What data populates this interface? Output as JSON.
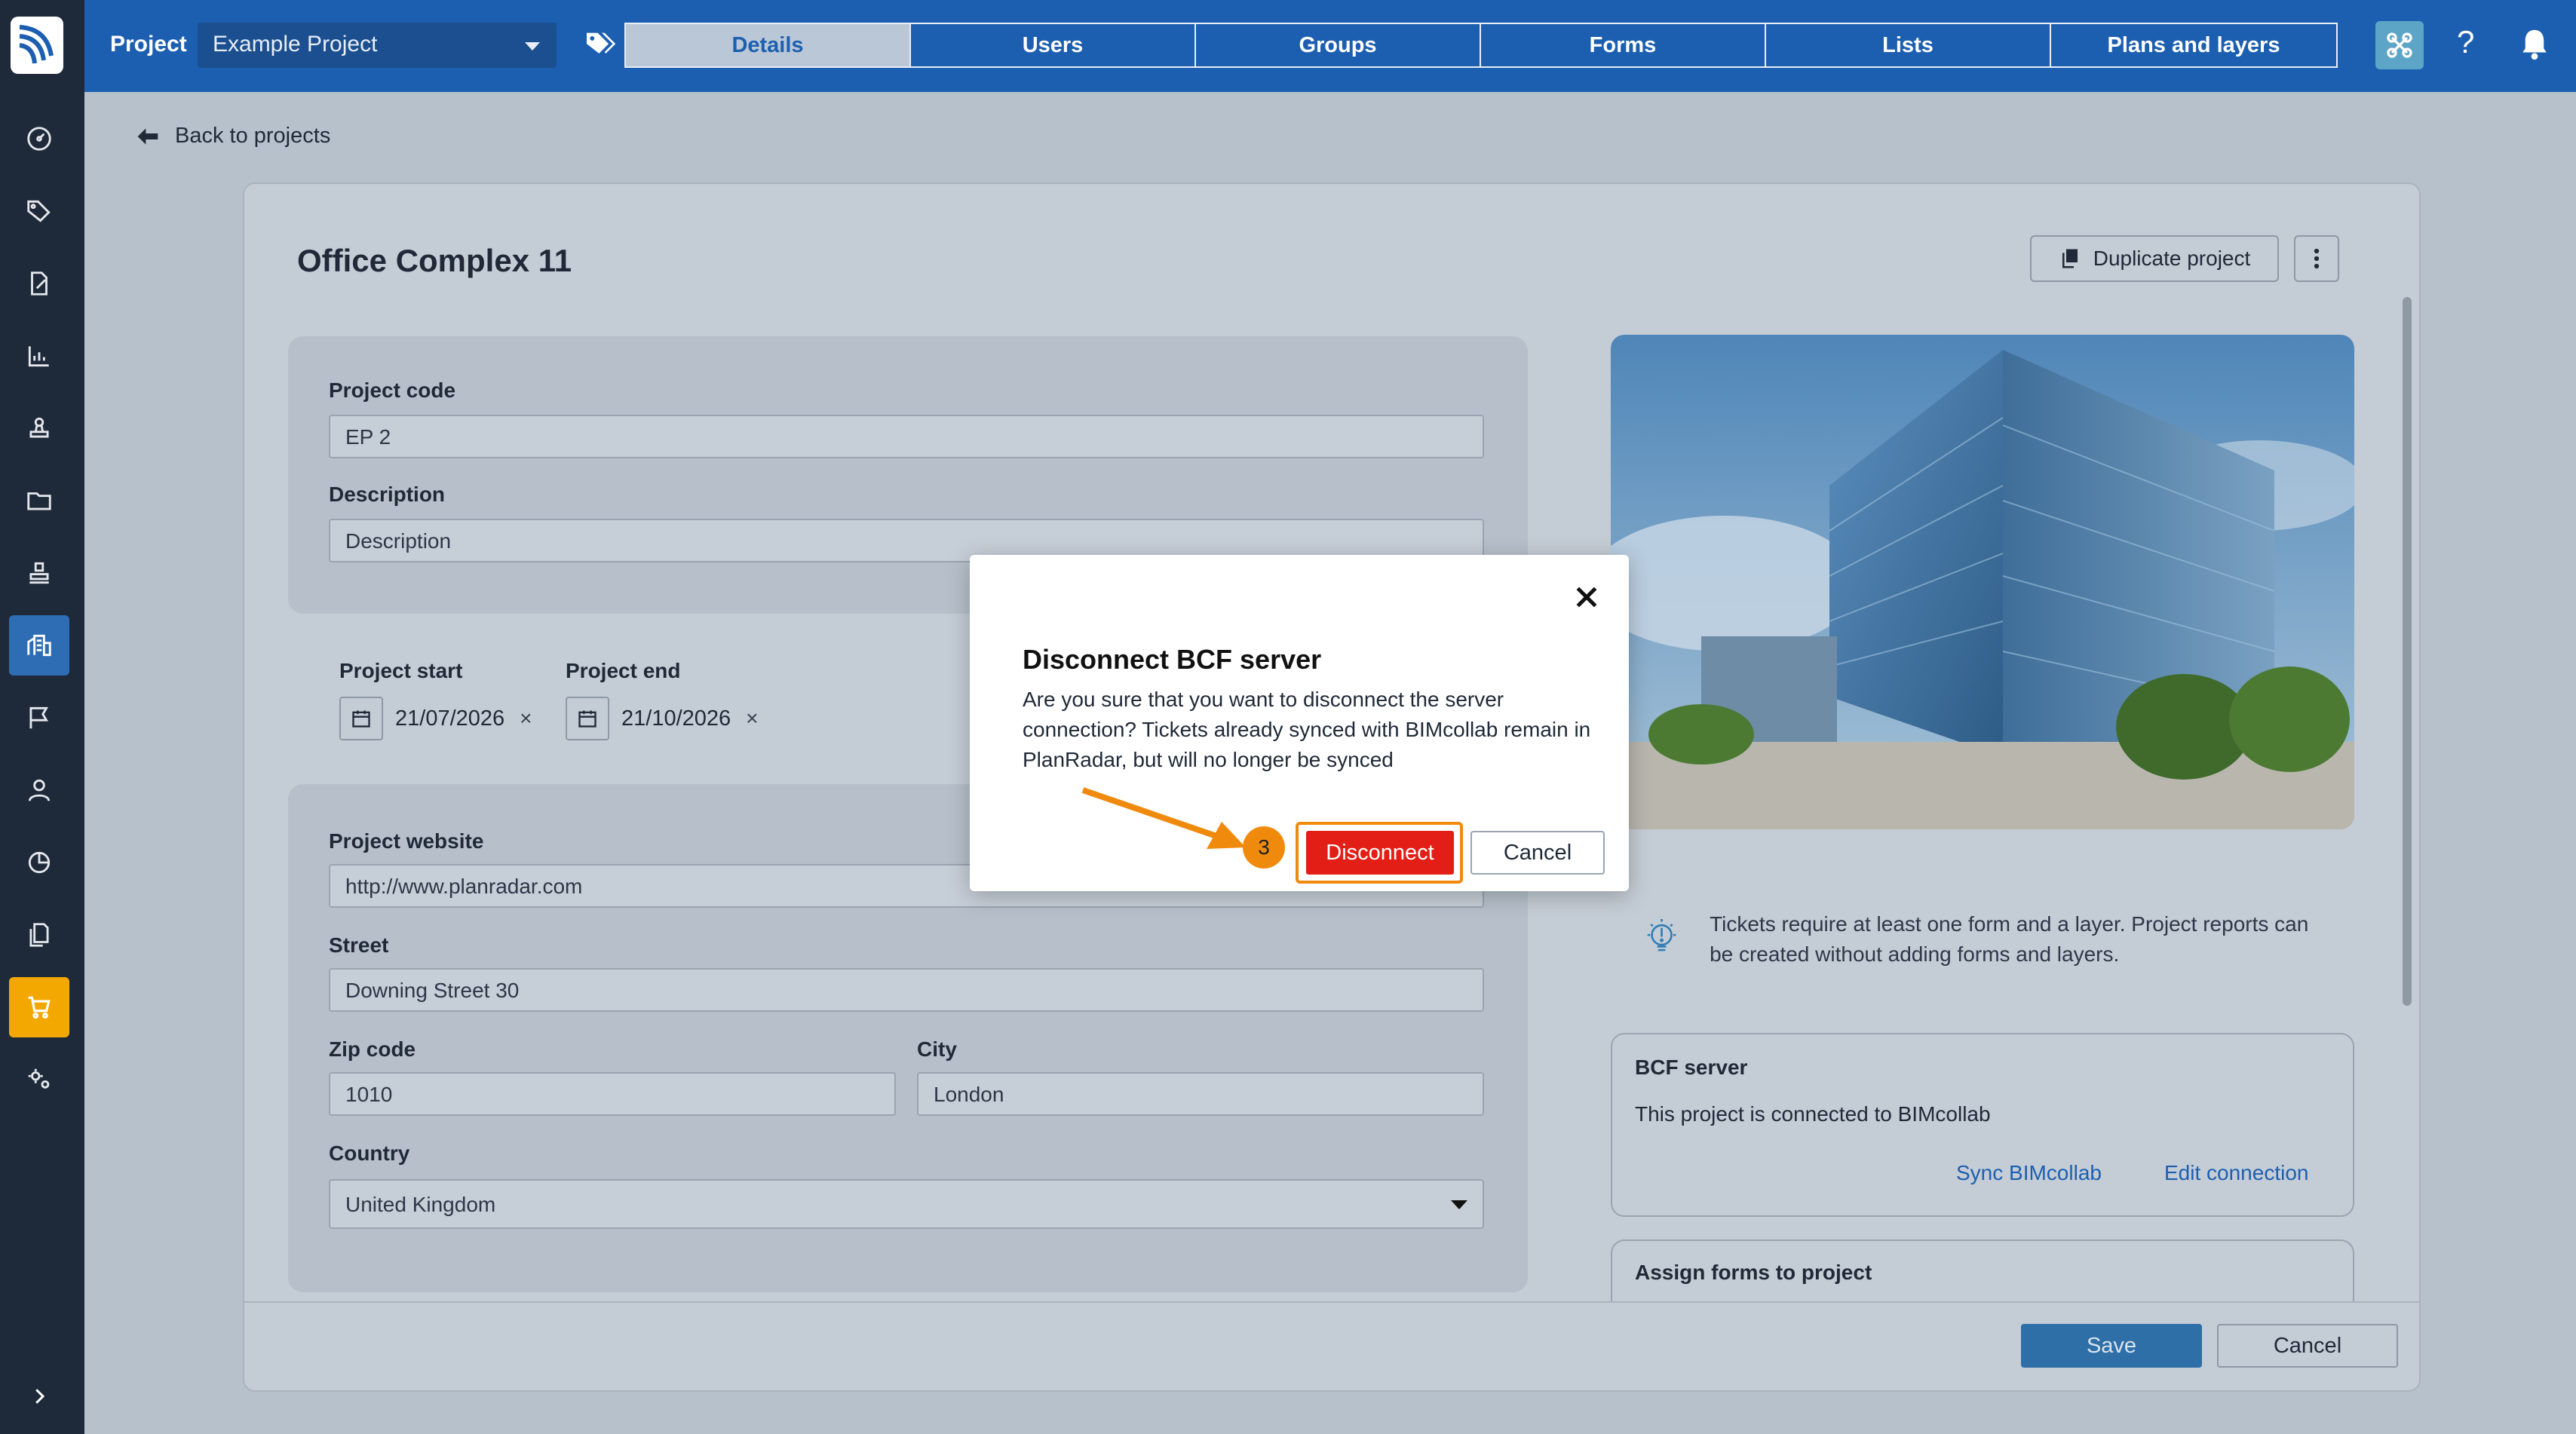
{
  "topbar": {
    "project_label": "Project",
    "project_select": "Example Project",
    "tabs": [
      {
        "label": "Details",
        "active": true
      },
      {
        "label": "Users"
      },
      {
        "label": "Groups"
      },
      {
        "label": "Forms"
      },
      {
        "label": "Lists"
      },
      {
        "label": "Plans and layers"
      }
    ],
    "help": "?"
  },
  "sidebar": {
    "items": [
      "dashboard-icon",
      "tags-icon",
      "edit-document-icon",
      "chart-icon",
      "stamp-icon",
      "folder-icon",
      "approval-icon",
      "projects-icon",
      "flag-icon",
      "user-icon",
      "pie-chart-icon",
      "documents-icon",
      "cart-icon",
      "settings-icon"
    ],
    "active_item": "projects-icon",
    "accent_item": "cart-icon",
    "colors": {
      "bg": "#1e2a3a",
      "active": "#2e6db4",
      "cart": "#f2a800"
    }
  },
  "page": {
    "back_link": "Back to projects",
    "title": "Office Complex 11",
    "duplicate_button": "Duplicate project"
  },
  "form": {
    "project_code_label": "Project code",
    "project_code_value": "EP 2",
    "description_label": "Description",
    "description_value": "Description",
    "project_start_label": "Project start",
    "project_start_value": "21/07/2026",
    "project_end_label": "Project end",
    "project_end_value": "21/10/2026",
    "clear_mark": "×",
    "website_label": "Project website",
    "website_value": "http://www.planradar.com",
    "street_label": "Street",
    "street_value": "Downing Street 30",
    "zip_label": "Zip code",
    "zip_value": "1010",
    "city_label": "City",
    "city_value": "London",
    "country_label": "Country",
    "country_value": "United Kingdom"
  },
  "right_panel": {
    "info_text": "Tickets require at least one form and a layer. Project reports can be created without adding forms and layers.",
    "bcf_title": "BCF server",
    "bcf_text": "This project is connected to BIMcollab",
    "sync_link": "Sync BIMcollab",
    "edit_link": "Edit connection",
    "assign_title": "Assign forms to project"
  },
  "footer": {
    "save": "Save",
    "cancel": "Cancel"
  },
  "modal": {
    "title": "Disconnect BCF server",
    "text": "Are you sure that you want to disconnect the server connection? Tickets already synced with BIMcollab remain in PlanRadar, but will no longer be synced",
    "step": "3",
    "disconnect": "Disconnect",
    "cancel": "Cancel",
    "colors": {
      "disconnect": "#e31e16",
      "highlight": "#f08a0c"
    }
  }
}
